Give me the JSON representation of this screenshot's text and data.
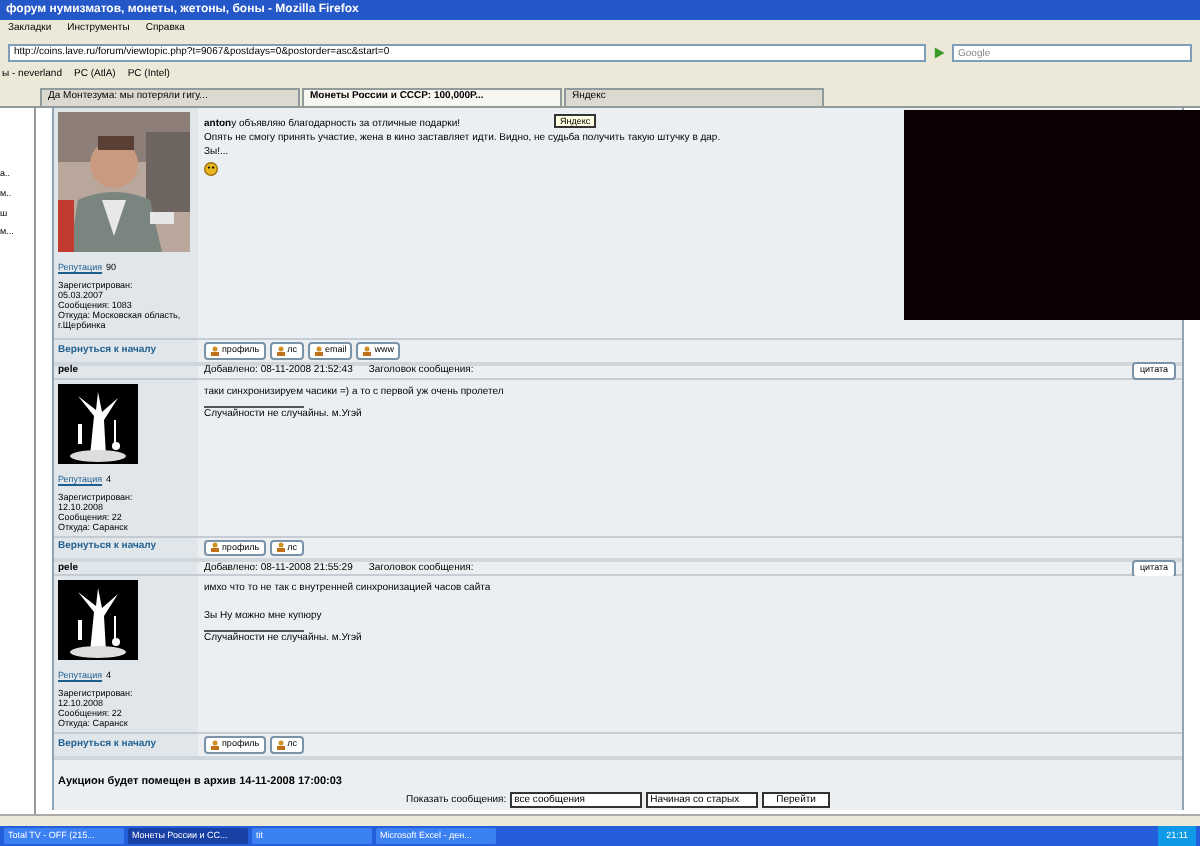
{
  "window": {
    "title": "форум нумизматов, монеты, жетоны, боны - Mozilla Firefox"
  },
  "menu": [
    "Закладки",
    "Инструменты",
    "Справка"
  ],
  "address": {
    "value": "http://coins.lave.ru/forum/viewtopic.php?t=9067&postdays=0&postorder=asc&start=0",
    "search_placeholder": "Google"
  },
  "bookmarks": [
    "ы - neverland",
    "PC (AtlA)",
    "PC (Intel)"
  ],
  "tabs": [
    {
      "label": "Да Монтезума: мы потеряли гигу...",
      "selected": false
    },
    {
      "label": "Монеты России и СССР: 100,000Р...",
      "selected": true
    },
    {
      "label": "Яндекс",
      "selected": false
    }
  ],
  "sidebar": {
    "items": [
      "а..",
      "м..",
      "ш",
      "м..."
    ]
  },
  "tooltip": "Яндекс",
  "posts": [
    {
      "reputation_label": "Репутация",
      "reputation": "90",
      "registered_label": "Зарегистрирован:",
      "registered": "05.03.2007",
      "messages": "Сообщения: 1083",
      "from": "Откуда: Московская область, г.Щербинка",
      "lines": [
        {
          "kind": "text",
          "text": "**anton**у объявляю благодарность за отличные подарки!"
        },
        {
          "kind": "text",
          "text": "Опять не смогу принять участие, жена в кино заставляет идти. Видно, не судьба получить такую штучку в дар."
        },
        {
          "kind": "text",
          "text": "Зы!..."
        },
        {
          "kind": "smiley"
        }
      ],
      "back": "Вернуться к началу",
      "buttons": [
        "профиль",
        "лс",
        "email",
        "www"
      ]
    },
    {
      "author": "pele",
      "posted": "Добавлено: 08-11-2008 21:52:43",
      "subject": "Заголовок сообщения:",
      "quote": "цитата",
      "reputation_label": "Репутация",
      "reputation": "4",
      "registered_label": "Зарегистрирован:",
      "registered": "12.10.2008",
      "messages": "Сообщения: 22",
      "from": "Откуда: Саранск",
      "lines": [
        {
          "kind": "text",
          "text": "таки синхронизируем часики =) а то с первой уж очень пролетел"
        }
      ],
      "signature": "Случайности не случайны. м.Угэй",
      "back": "Вернуться к началу",
      "buttons": [
        "профиль",
        "лс"
      ]
    },
    {
      "author": "pele",
      "posted": "Добавлено: 08-11-2008 21:55:29",
      "subject": "Заголовок сообщения:",
      "quote": "цитата",
      "reputation_label": "Репутация",
      "reputation": "4",
      "registered_label": "Зарегистрирован:",
      "registered": "12.10.2008",
      "messages": "Сообщения: 22",
      "from": "Откуда: Саранск",
      "lines": [
        {
          "kind": "text",
          "text": "имхо что то не так с внутренней синхронизацией часов сайта"
        },
        {
          "kind": "text",
          "spaced": true,
          "text": "Зы Ну можно мне купюру"
        }
      ],
      "signature": "Случайности не случайны. м.Угэй",
      "back": "Вернуться к началу",
      "buttons": [
        "профиль",
        "лс"
      ]
    }
  ],
  "archive_notice": "Аукцион будет помещен в архив 14-11-2008 17:00:03",
  "filter": {
    "label": "Показать сообщения:",
    "show": "все сообщения",
    "order": "Начиная со старых",
    "go": "Перейти"
  },
  "taskbar": {
    "items": [
      {
        "label": "Total TV - OFF (215...",
        "selected": false
      },
      {
        "label": "Монеты России и СС...",
        "selected": true
      },
      {
        "label": "tit",
        "selected": false
      },
      {
        "label": "Microsoft Excel - ден...",
        "selected": false
      }
    ],
    "clock": "21:11"
  }
}
